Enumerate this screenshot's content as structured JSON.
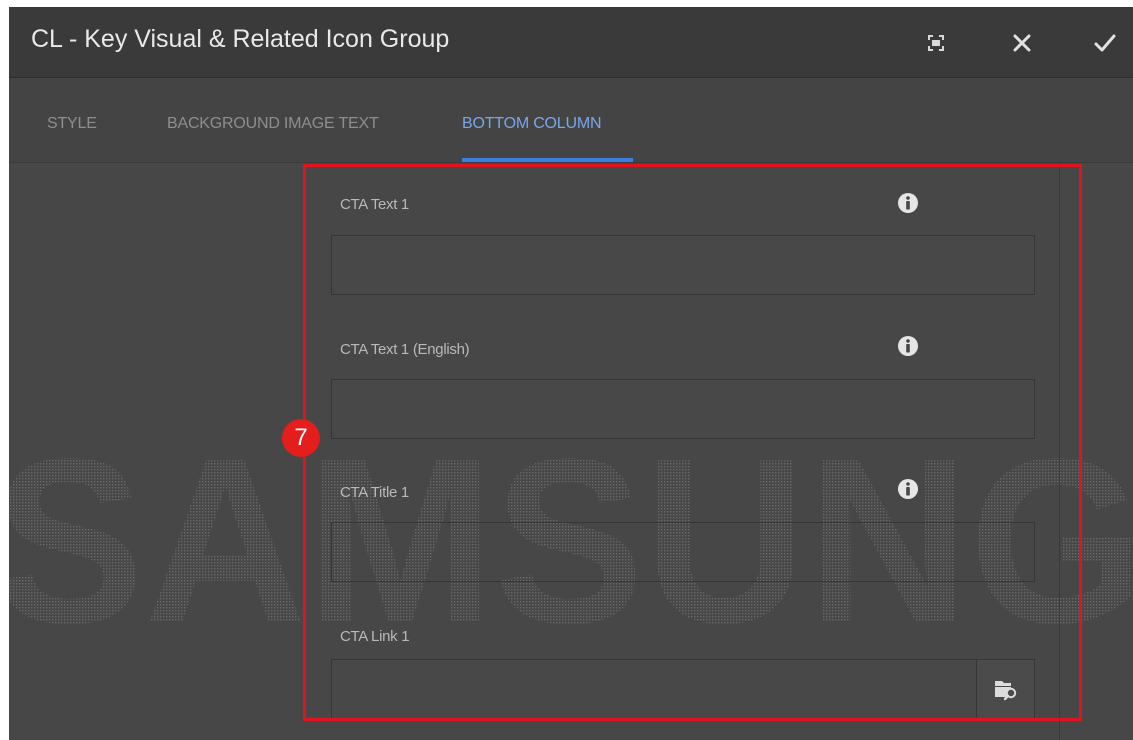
{
  "dialog": {
    "title": "CL - Key Visual & Related Icon Group",
    "actions": {
      "fullscreen_icon": "fullscreen-icon",
      "close_icon": "close-icon",
      "confirm_icon": "checkmark-icon"
    }
  },
  "tabs": [
    {
      "label": "STYLE",
      "active": false
    },
    {
      "label": "BACKGROUND IMAGE TEXT",
      "active": false
    },
    {
      "label": "BOTTOM COLUMN",
      "active": true
    }
  ],
  "fields": [
    {
      "label": "CTA Text 1",
      "value": "",
      "has_info": true
    },
    {
      "label": "CTA Text 1 (English)",
      "value": "",
      "has_info": true
    },
    {
      "label": "CTA Title 1",
      "value": "",
      "has_info": true
    },
    {
      "label": "CTA Link 1",
      "value": "",
      "has_info": false,
      "has_browse": true
    }
  ],
  "browse_icon": "path-browser-icon",
  "watermark": {
    "text": "SAMSUNG"
  },
  "annotation": {
    "step_number": "7",
    "highlight_color": "#e0141e"
  },
  "colors": {
    "accent": "#3d7ee0",
    "active_tab_text": "#7aa6e8",
    "dialog_bg": "#474747",
    "titlebar_bg": "#3a3a3a"
  }
}
